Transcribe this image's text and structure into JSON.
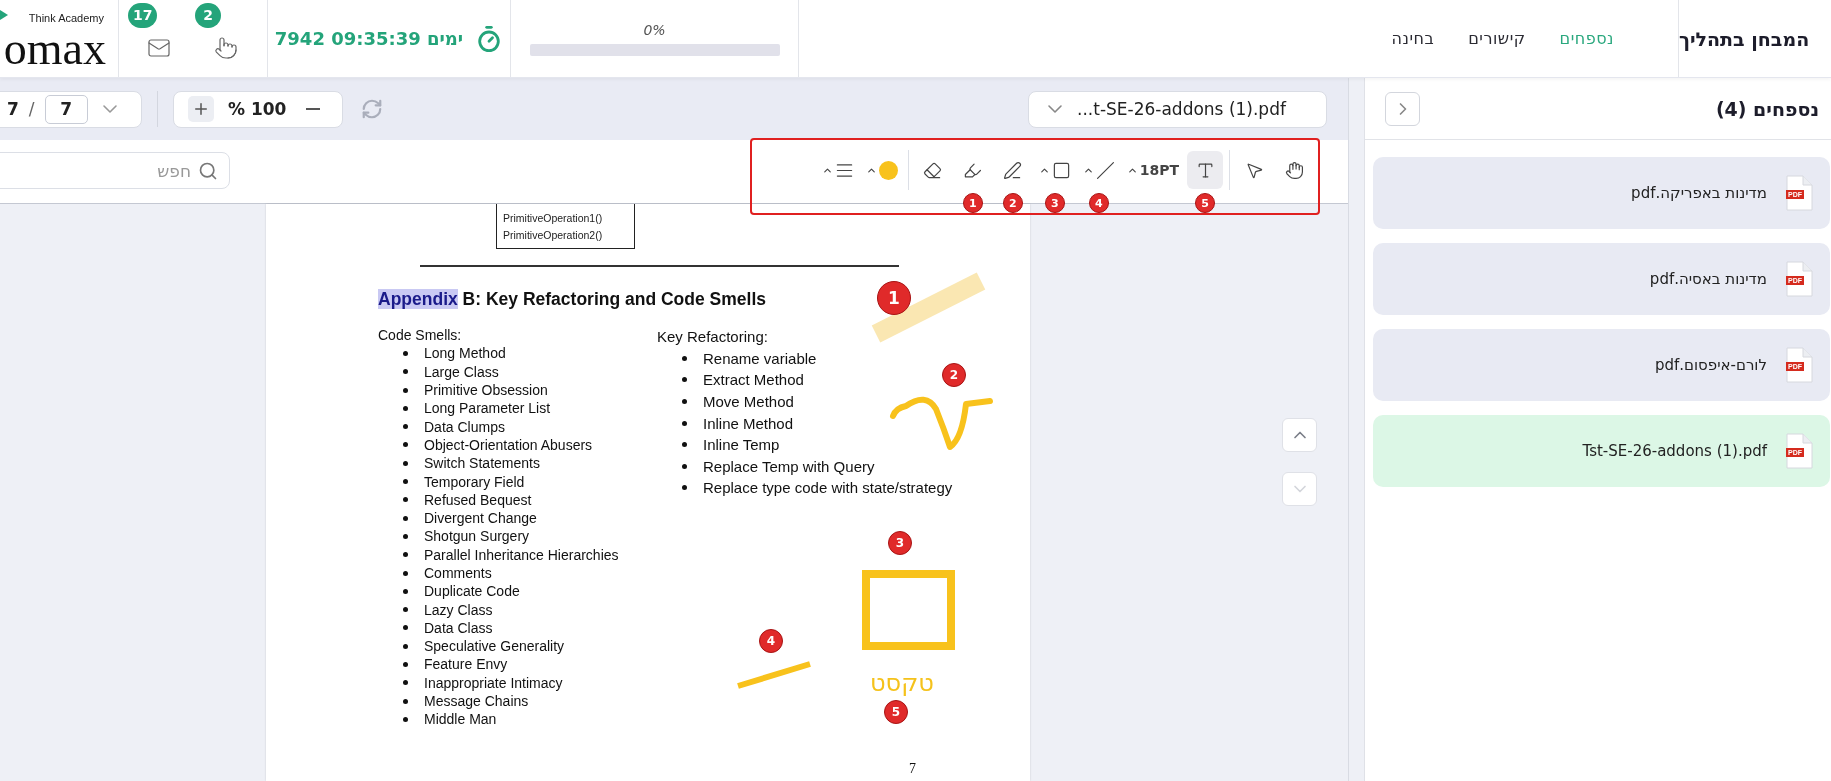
{
  "top_bar": {
    "logo": {
      "tagline": "Think Academy",
      "wordmark": "omax"
    },
    "notifications": [
      {
        "kind": "mail",
        "count": "17"
      },
      {
        "kind": "hand",
        "count": "2"
      }
    ],
    "timer": "7942 09:35:39 ימים",
    "progress": {
      "reading": "0%",
      "level": 0
    },
    "nav": [
      {
        "label": "נספחים",
        "selected": true
      },
      {
        "label": "קישורים",
        "selected": false
      },
      {
        "label": "בחינה",
        "selected": false
      }
    ],
    "title": "המבחן בתהליך"
  },
  "viewer_bar": {
    "total_pages": "7",
    "separator": "/",
    "current_page": "7",
    "zoom": "% 100",
    "file_name": "...t-SE-26-addons (1).pdf"
  },
  "search": {
    "placeholder": "חפש"
  },
  "tool_groups": [
    [
      {
        "kind": "menu",
        "selected": false,
        "caret": true
      },
      {
        "kind": "color",
        "color": "#f8c21c",
        "selected": false,
        "caret": true
      }
    ],
    [
      {
        "kind": "eraser",
        "selected": false,
        "caret": false
      },
      {
        "kind": "highlighter",
        "selected": false,
        "caret": false,
        "marker": "1"
      },
      {
        "kind": "pen",
        "selected": false,
        "caret": false,
        "marker": "2"
      },
      {
        "kind": "square",
        "selected": false,
        "caret": true,
        "marker": "3"
      },
      {
        "kind": "line",
        "selected": false,
        "caret": true,
        "marker": "4"
      },
      {
        "kind": "size",
        "label": "18PT",
        "selected": false,
        "caret": true
      },
      {
        "kind": "text",
        "selected": true,
        "caret": false,
        "marker": "5"
      }
    ],
    [
      {
        "kind": "pointer",
        "selected": false,
        "caret": false
      },
      {
        "kind": "hand",
        "selected": false,
        "caret": false
      }
    ]
  ],
  "document": {
    "box_lines": [
      "PrimitiveOperation1()",
      "PrimitiveOperation2()"
    ],
    "heading": {
      "highlighted": "Appendix",
      "rest": " B:  Key Refactoring and Code Smells"
    },
    "columns": [
      {
        "title": "Code Smells:",
        "items": [
          "Long Method",
          "Large Class",
          "Primitive Obsession",
          "Long Parameter List",
          "Data Clumps",
          "Object-Orientation Abusers",
          "Switch Statements",
          "Temporary Field",
          "Refused Bequest",
          "Divergent Change",
          "Shotgun Surgery",
          "Parallel Inheritance Hierarchies",
          "Comments",
          "Duplicate Code",
          "Lazy Class",
          "Data Class",
          "Speculative Generality",
          "Feature Envy",
          "Inappropriate Intimacy",
          "Message Chains",
          "Middle Man"
        ]
      },
      {
        "title": "Key Refactoring:",
        "items": [
          "Rename variable",
          "Extract Method",
          "Move Method",
          "Inline Method",
          "Inline Temp",
          "Replace Temp with Query",
          "Replace type code with state/strategy"
        ]
      }
    ],
    "page_number": "7",
    "annotations": [
      {
        "kind": "highlight",
        "marker": "1"
      },
      {
        "kind": "freehand",
        "marker": "2"
      },
      {
        "kind": "rectangle",
        "marker": "3"
      },
      {
        "kind": "line",
        "marker": "4"
      },
      {
        "kind": "text",
        "text": "טקסט",
        "marker": "5"
      }
    ]
  },
  "scroll_buttons": [
    {
      "kind": "up",
      "disabled": false
    },
    {
      "kind": "down",
      "disabled": true
    }
  ],
  "sidebar": {
    "title": "נספחים (4)",
    "files": [
      {
        "name": "מדינות באפריקה.pdf",
        "type": "PDF",
        "selected": false
      },
      {
        "name": "מדינות באסיה.pdf",
        "type": "PDF",
        "selected": false
      },
      {
        "name": "לורם-איפסום.pdf",
        "type": "PDF",
        "selected": false
      },
      {
        "name": "Tst-SE-26-addons (1).pdf",
        "type": "PDF",
        "selected": true
      }
    ]
  }
}
